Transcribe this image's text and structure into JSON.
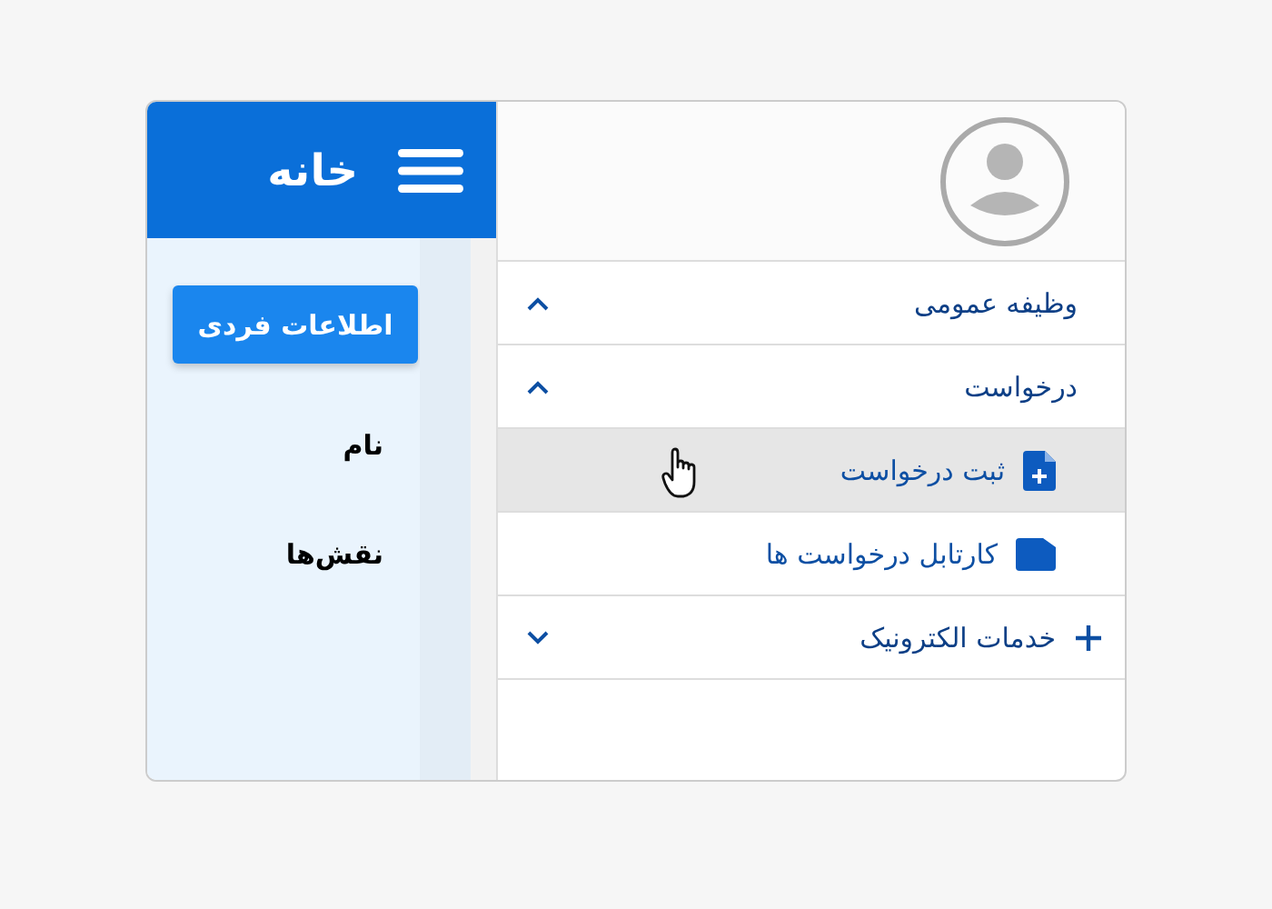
{
  "header": {
    "title": "خانه"
  },
  "profile_button": "اطلاعات فردی",
  "fields": [
    "نام",
    "نقش‌ها"
  ],
  "menu": [
    {
      "label": "وظیفه عمومی",
      "kind": "group",
      "expanded": true
    },
    {
      "label": "درخواست",
      "kind": "group",
      "expanded": true,
      "children": [
        {
          "label": "ثبت درخواست",
          "kind": "file",
          "selected": true
        },
        {
          "label": "کارتابل درخواست ها",
          "kind": "folder",
          "selected": false
        }
      ]
    },
    {
      "label": "خدمات الکترونیک",
      "kind": "service",
      "expanded": false
    }
  ]
}
